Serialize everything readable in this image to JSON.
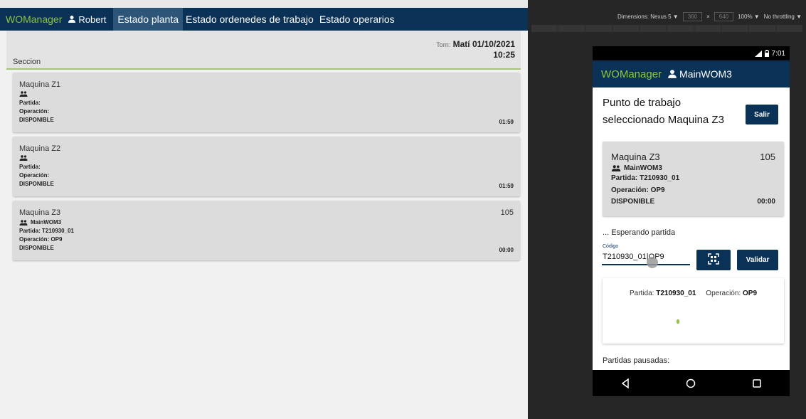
{
  "app": {
    "brand": "WOManager",
    "user": "Robert",
    "nav": [
      {
        "label": "Estado planta",
        "active": true
      },
      {
        "label": "Estado ordenedes de trabajo",
        "active": false
      },
      {
        "label": "Estado operarios",
        "active": false
      }
    ]
  },
  "plant": {
    "turn_prefix": "Torn:",
    "turn_name": "Matí",
    "date": "01/10/2021",
    "time": "10:25",
    "section_label": "Seccion",
    "machines": [
      {
        "name": "Maquina Z1",
        "operator": "",
        "partida": "Partida:",
        "operacion": "Operación:",
        "status": "DISPONIBLE",
        "time": "01:59",
        "count": ""
      },
      {
        "name": "Maquina Z2",
        "operator": "",
        "partida": "Partida:",
        "operacion": "Operación:",
        "status": "DISPONIBLE",
        "time": "01:59",
        "count": ""
      },
      {
        "name": "Maquina Z3",
        "operator": "MainWOM3",
        "partida": "Partida: T210930_01",
        "operacion": "Operación: OP9",
        "status": "DISPONIBLE",
        "time": "00:00",
        "count": "105"
      }
    ]
  },
  "devtools": {
    "dimensions": "Dimensions: Nexus 5 ▼",
    "width": "360",
    "x": "×",
    "height": "640",
    "zoom": "100% ▼",
    "throttle": "No throttling ▼"
  },
  "phone": {
    "clock": "7:01",
    "brand": "WOManager",
    "user": "MainWOM3",
    "title": "Punto de trabajo seleccionado Maquina Z3",
    "salir": "Salir",
    "card": {
      "name": "Maquina Z3",
      "count": "105",
      "operator": "MainWOM3",
      "partida": "Partida: T210930_01",
      "operacion": "Operación: OP9",
      "status": "DISPONIBLE",
      "time": "00:00"
    },
    "waiting": "... Esperando partida",
    "code_label": "Código",
    "code_value": "T210930_01|OP9",
    "validar": "Validar",
    "info_partida_label": "Partida:",
    "info_partida_value": "T210930_01",
    "info_operacion_label": "Operación:",
    "info_operacion_value": "OP9",
    "paused": "Partidas pausadas:"
  },
  "icons": {
    "user": "person-icon",
    "group": "group-icon",
    "scan": "qr-scan-icon",
    "nav_back": "back-icon",
    "nav_home": "home-icon",
    "nav_recent": "recent-apps-icon"
  },
  "colors": {
    "navy": "#0a3156",
    "brand_green": "#8ec63f",
    "card_gray": "#dcdcdc"
  }
}
